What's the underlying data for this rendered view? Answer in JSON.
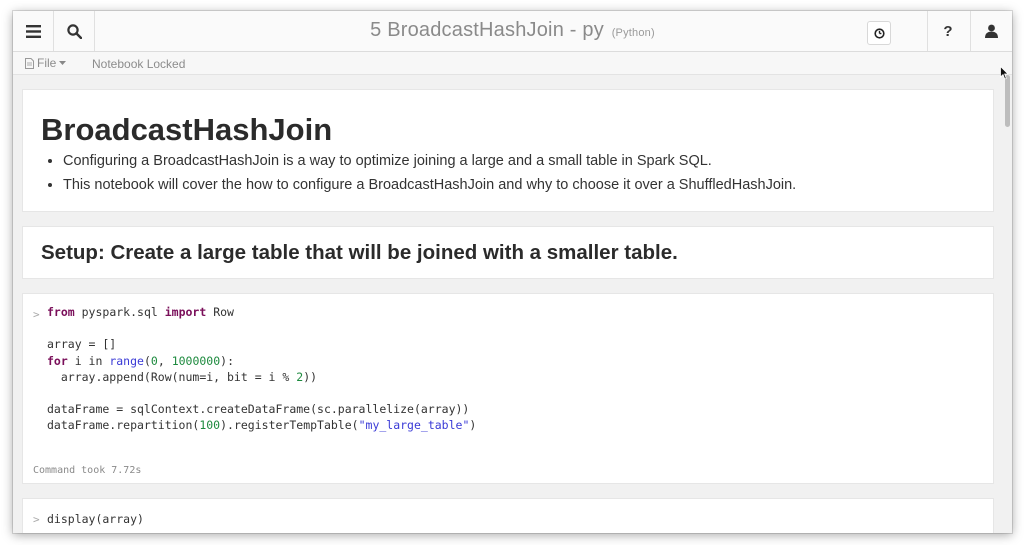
{
  "header": {
    "notebook_title": "5 BroadcastHashJoin - py",
    "language": "(Python)",
    "menu_icon": "hamburger-icon",
    "search_icon": "search-icon",
    "clock_icon": "clock-icon",
    "help_label": "?",
    "user_icon": "user-icon"
  },
  "toolbar": {
    "file_label": "File",
    "status": "Notebook Locked"
  },
  "cells": {
    "intro": {
      "heading": "BroadcastHashJoin",
      "bullets": [
        "Configuring a BroadcastHashJoin is a way to optimize joining a large and a small table in Spark SQL.",
        "This notebook will cover the how to configure a BroadcastHashJoin and why to choose it over a ShuffledHashJoin."
      ]
    },
    "setup": {
      "heading": "Setup: Create a large table that will be joined with a smaller table."
    },
    "code1": {
      "chevron": ">",
      "tokens": {
        "from": "from",
        "module": " pyspark.sql ",
        "import": "import",
        "row": " Row",
        "array_init": "array = []",
        "for": "for",
        "i_in": " i in ",
        "range": "range",
        "open": "(",
        "zero": "0",
        "comma": ", ",
        "million": "1000000",
        "close": "):",
        "append_a": "  array.append(Row(num=i, bit = i % ",
        "two": "2",
        "append_b": "))",
        "df_line": "dataFrame = sqlContext.createDataFrame(sc.parallelize(array))",
        "rep_a": "dataFrame.repartition(",
        "hundred": "100",
        "rep_b": ").registerTempTable(",
        "table_name": "\"my_large_table\"",
        "rep_c": ")"
      },
      "status": "Command took 7.72s"
    },
    "code2": {
      "chevron": ">",
      "code": "display(array)"
    }
  },
  "colors": {
    "keyword": "#7a0f5a",
    "builtin": "#3a3ad6",
    "number": "#1d8a3e",
    "string": "#3a3ad6"
  }
}
